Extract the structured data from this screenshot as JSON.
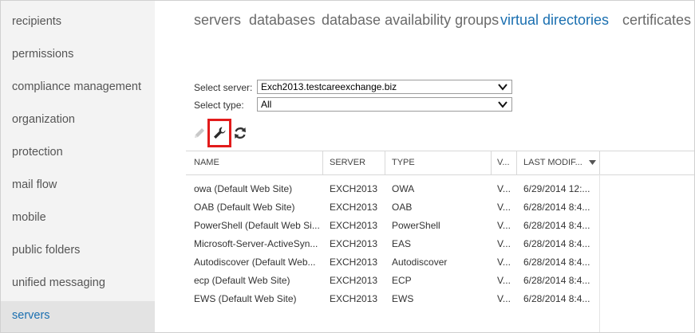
{
  "sidebar": {
    "items": [
      {
        "label": "recipients"
      },
      {
        "label": "permissions"
      },
      {
        "label": "compliance management"
      },
      {
        "label": "organization"
      },
      {
        "label": "protection"
      },
      {
        "label": "mail flow"
      },
      {
        "label": "mobile"
      },
      {
        "label": "public folders"
      },
      {
        "label": "unified messaging"
      },
      {
        "label": "servers",
        "active": true
      }
    ]
  },
  "tabs": [
    {
      "label": "servers"
    },
    {
      "label": "databases"
    },
    {
      "label": "database availability groups"
    },
    {
      "label": "virtual directories",
      "active": true
    },
    {
      "label": "certificates"
    }
  ],
  "filters": {
    "server_label": "Select server:",
    "server_value": "Exch2013.testcareexchange.biz",
    "type_label": "Select type:",
    "type_value": "All"
  },
  "toolbar": {
    "icons": [
      "pencil-icon",
      "wrench-icon",
      "refresh-icon"
    ]
  },
  "table": {
    "columns": [
      "NAME",
      "SERVER",
      "TYPE",
      "V...",
      "LAST MODIF..."
    ],
    "rows": [
      [
        "owa (Default Web Site)",
        "EXCH2013",
        "OWA",
        "V...",
        "6/29/2014 12:..."
      ],
      [
        "OAB (Default Web Site)",
        "EXCH2013",
        "OAB",
        "V...",
        "6/28/2014 8:4..."
      ],
      [
        "PowerShell (Default Web Si...",
        "EXCH2013",
        "PowerShell",
        "V...",
        "6/28/2014 8:4..."
      ],
      [
        "Microsoft-Server-ActiveSyn...",
        "EXCH2013",
        "EAS",
        "V...",
        "6/28/2014 8:4..."
      ],
      [
        "Autodiscover (Default Web...",
        "EXCH2013",
        "Autodiscover",
        "V...",
        "6/28/2014 8:4..."
      ],
      [
        "ecp (Default Web Site)",
        "EXCH2013",
        "ECP",
        "V...",
        "6/28/2014 8:4..."
      ],
      [
        "EWS (Default Web Site)",
        "EXCH2013",
        "EWS",
        "V...",
        "6/28/2014 8:4..."
      ]
    ]
  },
  "colors": {
    "accent": "#1a6fb0",
    "highlight_box": "#e21b1b",
    "sidebar_bg": "#f3f3f3"
  }
}
